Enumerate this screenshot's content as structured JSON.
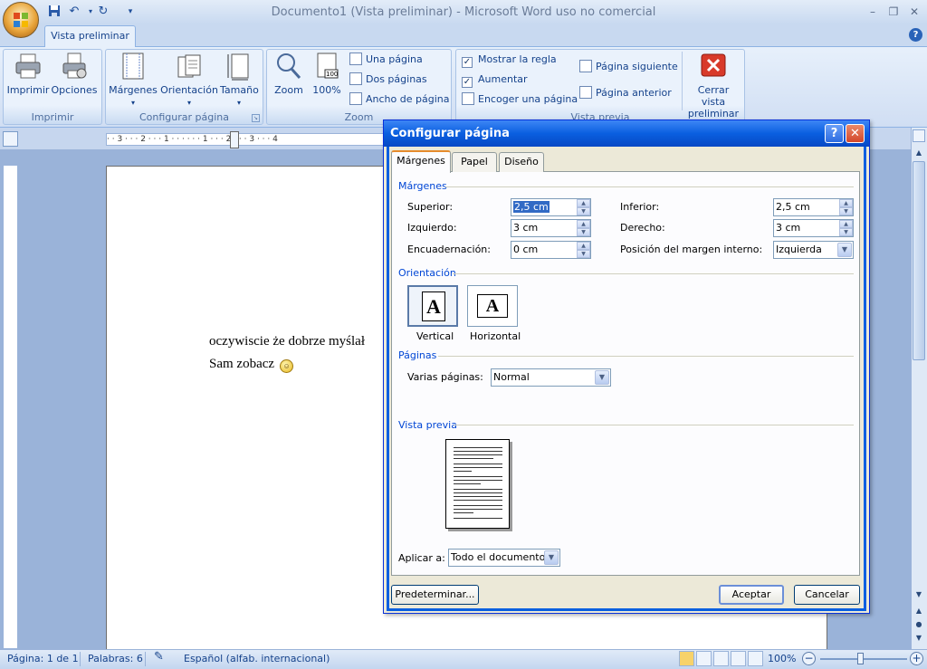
{
  "app": {
    "title": "Documento1 (Vista preliminar) - Microsoft Word uso no comercial",
    "minimize": "–",
    "restore": "❐",
    "close": "✕"
  },
  "quick_access": {
    "save_icon": "save-icon",
    "undo_icon": "undo-icon",
    "redo_icon": "redo-icon"
  },
  "ribbon": {
    "active_tab": "Vista preliminar",
    "help": "?",
    "groups": {
      "print": {
        "label": "Imprimir",
        "print_btn": "Imprimir",
        "options_btn": "Opciones"
      },
      "page_setup": {
        "label": "Configurar página",
        "margins_btn": "Márgenes",
        "orientation_btn": "Orientación",
        "size_btn": "Tamaño"
      },
      "zoom": {
        "label": "Zoom",
        "zoom_btn": "Zoom",
        "percent_btn": "100%",
        "one_page": "Una página",
        "two_pages": "Dos páginas",
        "page_width": "Ancho de página"
      },
      "preview": {
        "label": "Vista previa",
        "show_ruler": "Mostrar la regla",
        "show_ruler_checked": true,
        "magnifier": "Aumentar",
        "magnifier_checked": true,
        "shrink": "Encoger una página",
        "next_page": "Página siguiente",
        "prev_page": "Página anterior",
        "close_preview_line1": "Cerrar vista",
        "close_preview_line2": "preliminar"
      }
    }
  },
  "ruler": {
    "horizontal": "· · 3 · · · 2 · · · 1 · · ·   · · · 1 · · · 2 · · · 3 · · · 4"
  },
  "document": {
    "line1": "oczywiscie że dobrze myślał",
    "line2": "Sam zobacz"
  },
  "statusbar": {
    "page": "Página: 1 de 1",
    "words": "Palabras: 6",
    "language": "Español (alfab. internacional)",
    "zoom": "100%",
    "zoom_level": 100
  },
  "dialog": {
    "title": "Configurar página",
    "help": "?",
    "close": "✕",
    "tabs": [
      "Márgenes",
      "Papel",
      "Diseño"
    ],
    "active_tab": "Márgenes",
    "margins_section": "Márgenes",
    "top_label": "Superior:",
    "top_value": "2,5 cm",
    "bottom_label": "Inferior:",
    "bottom_value": "2,5 cm",
    "left_label": "Izquierdo:",
    "left_value": "3 cm",
    "right_label": "Derecho:",
    "right_value": "3 cm",
    "gutter_label": "Encuadernación:",
    "gutter_value": "0 cm",
    "gutter_pos_label": "Posición del margen interno:",
    "gutter_pos_value": "Izquierda",
    "orientation_section": "Orientación",
    "portrait": "Vertical",
    "landscape": "Horizontal",
    "orientation_glyph": "A",
    "pages_section": "Páginas",
    "multiple_pages_label": "Varias páginas:",
    "multiple_pages_value": "Normal",
    "preview_section": "Vista previa",
    "apply_label": "Aplicar a:",
    "apply_value": "Todo el documento",
    "default_btn": "Predeterminar...",
    "ok_btn": "Aceptar",
    "cancel_btn": "Cancelar"
  }
}
